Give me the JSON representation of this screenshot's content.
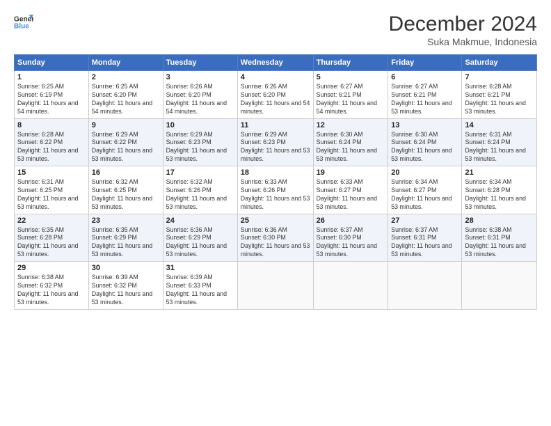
{
  "header": {
    "logo_line1": "General",
    "logo_line2": "Blue",
    "month_title": "December 2024",
    "location": "Suka Makmue, Indonesia"
  },
  "days_of_week": [
    "Sunday",
    "Monday",
    "Tuesday",
    "Wednesday",
    "Thursday",
    "Friday",
    "Saturday"
  ],
  "weeks": [
    [
      {
        "day": 1,
        "sunrise": "6:25 AM",
        "sunset": "6:19 PM",
        "daylight": "11 hours and 54 minutes."
      },
      {
        "day": 2,
        "sunrise": "6:25 AM",
        "sunset": "6:20 PM",
        "daylight": "11 hours and 54 minutes."
      },
      {
        "day": 3,
        "sunrise": "6:26 AM",
        "sunset": "6:20 PM",
        "daylight": "11 hours and 54 minutes."
      },
      {
        "day": 4,
        "sunrise": "6:26 AM",
        "sunset": "6:20 PM",
        "daylight": "11 hours and 54 minutes."
      },
      {
        "day": 5,
        "sunrise": "6:27 AM",
        "sunset": "6:21 PM",
        "daylight": "11 hours and 54 minutes."
      },
      {
        "day": 6,
        "sunrise": "6:27 AM",
        "sunset": "6:21 PM",
        "daylight": "11 hours and 53 minutes."
      },
      {
        "day": 7,
        "sunrise": "6:28 AM",
        "sunset": "6:21 PM",
        "daylight": "11 hours and 53 minutes."
      }
    ],
    [
      {
        "day": 8,
        "sunrise": "6:28 AM",
        "sunset": "6:22 PM",
        "daylight": "11 hours and 53 minutes."
      },
      {
        "day": 9,
        "sunrise": "6:29 AM",
        "sunset": "6:22 PM",
        "daylight": "11 hours and 53 minutes."
      },
      {
        "day": 10,
        "sunrise": "6:29 AM",
        "sunset": "6:23 PM",
        "daylight": "11 hours and 53 minutes."
      },
      {
        "day": 11,
        "sunrise": "6:29 AM",
        "sunset": "6:23 PM",
        "daylight": "11 hours and 53 minutes."
      },
      {
        "day": 12,
        "sunrise": "6:30 AM",
        "sunset": "6:24 PM",
        "daylight": "11 hours and 53 minutes."
      },
      {
        "day": 13,
        "sunrise": "6:30 AM",
        "sunset": "6:24 PM",
        "daylight": "11 hours and 53 minutes."
      },
      {
        "day": 14,
        "sunrise": "6:31 AM",
        "sunset": "6:24 PM",
        "daylight": "11 hours and 53 minutes."
      }
    ],
    [
      {
        "day": 15,
        "sunrise": "6:31 AM",
        "sunset": "6:25 PM",
        "daylight": "11 hours and 53 minutes."
      },
      {
        "day": 16,
        "sunrise": "6:32 AM",
        "sunset": "6:25 PM",
        "daylight": "11 hours and 53 minutes."
      },
      {
        "day": 17,
        "sunrise": "6:32 AM",
        "sunset": "6:26 PM",
        "daylight": "11 hours and 53 minutes."
      },
      {
        "day": 18,
        "sunrise": "6:33 AM",
        "sunset": "6:26 PM",
        "daylight": "11 hours and 53 minutes."
      },
      {
        "day": 19,
        "sunrise": "6:33 AM",
        "sunset": "6:27 PM",
        "daylight": "11 hours and 53 minutes."
      },
      {
        "day": 20,
        "sunrise": "6:34 AM",
        "sunset": "6:27 PM",
        "daylight": "11 hours and 53 minutes."
      },
      {
        "day": 21,
        "sunrise": "6:34 AM",
        "sunset": "6:28 PM",
        "daylight": "11 hours and 53 minutes."
      }
    ],
    [
      {
        "day": 22,
        "sunrise": "6:35 AM",
        "sunset": "6:28 PM",
        "daylight": "11 hours and 53 minutes."
      },
      {
        "day": 23,
        "sunrise": "6:35 AM",
        "sunset": "6:29 PM",
        "daylight": "11 hours and 53 minutes."
      },
      {
        "day": 24,
        "sunrise": "6:36 AM",
        "sunset": "6:29 PM",
        "daylight": "11 hours and 53 minutes."
      },
      {
        "day": 25,
        "sunrise": "6:36 AM",
        "sunset": "6:30 PM",
        "daylight": "11 hours and 53 minutes."
      },
      {
        "day": 26,
        "sunrise": "6:37 AM",
        "sunset": "6:30 PM",
        "daylight": "11 hours and 53 minutes."
      },
      {
        "day": 27,
        "sunrise": "6:37 AM",
        "sunset": "6:31 PM",
        "daylight": "11 hours and 53 minutes."
      },
      {
        "day": 28,
        "sunrise": "6:38 AM",
        "sunset": "6:31 PM",
        "daylight": "11 hours and 53 minutes."
      }
    ],
    [
      {
        "day": 29,
        "sunrise": "6:38 AM",
        "sunset": "6:32 PM",
        "daylight": "11 hours and 53 minutes."
      },
      {
        "day": 30,
        "sunrise": "6:39 AM",
        "sunset": "6:32 PM",
        "daylight": "11 hours and 53 minutes."
      },
      {
        "day": 31,
        "sunrise": "6:39 AM",
        "sunset": "6:33 PM",
        "daylight": "11 hours and 53 minutes."
      },
      null,
      null,
      null,
      null
    ]
  ]
}
